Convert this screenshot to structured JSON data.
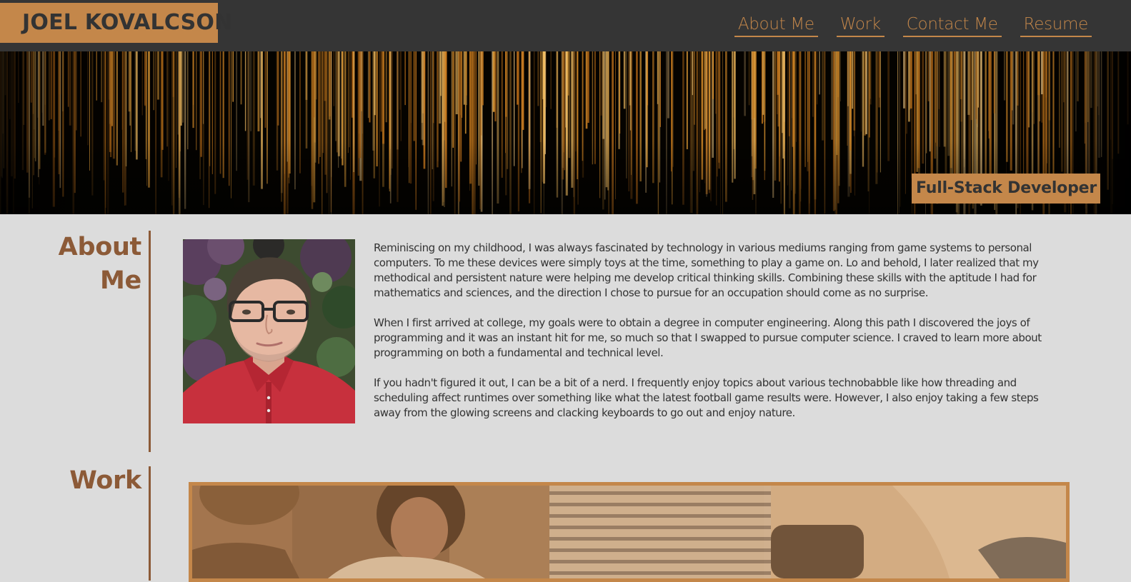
{
  "header": {
    "logo": "JOEL KOVALCSON",
    "nav": [
      {
        "label": "About Me"
      },
      {
        "label": "Work"
      },
      {
        "label": "Contact Me"
      },
      {
        "label": "Resume"
      }
    ]
  },
  "hero": {
    "tagline": "Full-Stack Developer"
  },
  "about": {
    "title_line1": "About",
    "title_line2": "Me",
    "paragraphs": [
      "Reminiscing on my childhood, I was always fascinated by technology in various mediums ranging from game systems to personal computers. To me these devices were simply toys at the time, something to play a game on. Lo and behold, I later realized that my methodical and persistent nature were helping me develop critical thinking skills. Combining these skills with the aptitude I had for mathematics and sciences, and the direction I chose to pursue for an occupation should come as no surprise.",
      "When I first arrived at college, my goals were to obtain a degree in computer engineering. Along this path I discovered the joys of programming and it was an instant hit for me, so much so that I swapped to pursue computer science. I craved to learn more about programming on both a fundamental and technical level.",
      "If you hadn't figured it out, I can be a bit of a nerd. I frequently enjoy topics about various technobabble like how threading and scheduling affect runtimes over something like what the latest football game results were. However, I also enjoy taking a few steps away from the glowing screens and clacking keyboards to go out and enjoy nature."
    ]
  },
  "work": {
    "title": "Work"
  },
  "colors": {
    "accent": "#c4874a",
    "heading": "#8c5a37",
    "header_bg": "#353535",
    "page_bg": "#dcdcdc",
    "text": "#333333"
  }
}
